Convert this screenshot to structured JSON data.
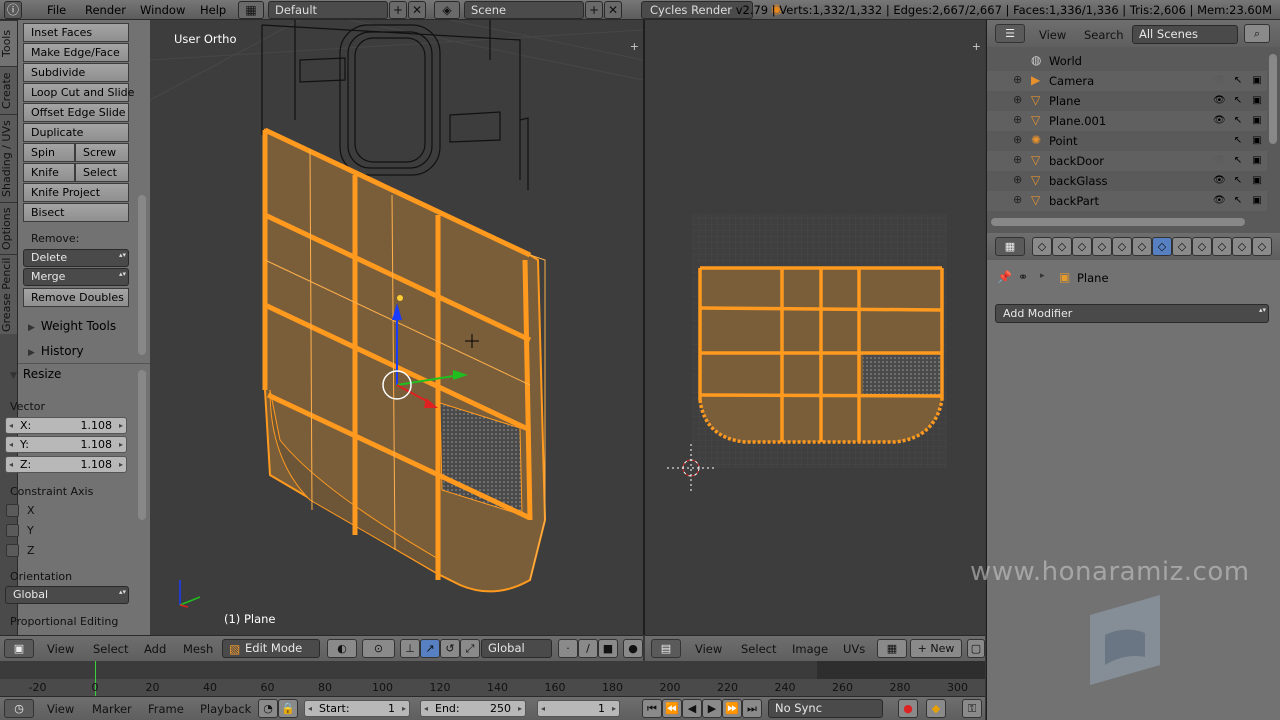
{
  "topbar": {
    "menus": [
      "File",
      "Render",
      "Window",
      "Help"
    ],
    "layout": "Default",
    "scene": "Scene",
    "engine": "Cycles Render",
    "stats": "v2.79 | Verts:1,332/1,332 | Edges:2,667/2,667 | Faces:1,336/1,336 | Tris:2,606 | Mem:23.60M"
  },
  "side_tabs": [
    "Tools",
    "Create",
    "Shading / UVs",
    "Options",
    "Grease Pencil"
  ],
  "tools": {
    "inset": "Inset Faces",
    "make_edge": "Make Edge/Face",
    "subdivide": "Subdivide",
    "loopcut": "Loop Cut and Slide",
    "offset_edge": "Offset Edge Slide",
    "duplicate": "Duplicate",
    "spin": "Spin",
    "screw": "Screw",
    "knife": "Knife",
    "select": "Select",
    "knife_project": "Knife Project",
    "bisect": "Bisect",
    "remove_label": "Remove:",
    "delete": "Delete",
    "merge": "Merge",
    "remove_doubles": "Remove Doubles",
    "weight_tools": "Weight Tools",
    "history": "History"
  },
  "resize": {
    "title": "Resize",
    "vector_label": "Vector",
    "x_label": "X:",
    "x": "1.108",
    "y_label": "Y:",
    "y": "1.108",
    "z_label": "Z:",
    "z": "1.108",
    "constraint_label": "Constraint Axis",
    "cx": "X",
    "cy": "Y",
    "cz": "Z",
    "orientation_label": "Orientation",
    "orientation": "Global",
    "proportional_label": "Proportional Editing"
  },
  "viewport": {
    "view_name": "User Ortho",
    "object_label": "(1) Plane",
    "menus": [
      "View",
      "Select",
      "Add",
      "Mesh"
    ],
    "mode": "Edit Mode",
    "orientation": "Global"
  },
  "uv_editor": {
    "menus": [
      "View",
      "Select",
      "Image",
      "UVs"
    ],
    "new_label": "New"
  },
  "timeline": {
    "ticks": [
      "-20",
      "0",
      "20",
      "40",
      "60",
      "80",
      "100",
      "120",
      "140",
      "160",
      "180",
      "200",
      "220",
      "240",
      "260",
      "280",
      "300"
    ],
    "menus": [
      "View",
      "Marker",
      "Frame",
      "Playback"
    ],
    "start_label": "Start:",
    "start": "1",
    "end_label": "End:",
    "end": "250",
    "current": "1",
    "sync": "No Sync"
  },
  "outliner": {
    "menus": [
      "View",
      "Search"
    ],
    "filter": "All Scenes",
    "items": [
      {
        "name": "World",
        "icon": "world-icon"
      },
      {
        "name": "Camera",
        "icon": "camera-icon"
      },
      {
        "name": "Plane",
        "icon": "mesh-icon"
      },
      {
        "name": "Plane.001",
        "icon": "mesh-icon"
      },
      {
        "name": "Point",
        "icon": "lamp-icon"
      },
      {
        "name": "backDoor",
        "icon": "mesh-icon"
      },
      {
        "name": "backGlass",
        "icon": "mesh-icon"
      },
      {
        "name": "backPart",
        "icon": "mesh-icon"
      }
    ]
  },
  "properties": {
    "object": "Plane",
    "add_modifier": "Add Modifier"
  },
  "watermark": "www.honaramiz.com",
  "colors": {
    "select_orange": "#ff9a1f",
    "face_fill": "#8a6a3f",
    "bg": "#3d3d3d"
  }
}
